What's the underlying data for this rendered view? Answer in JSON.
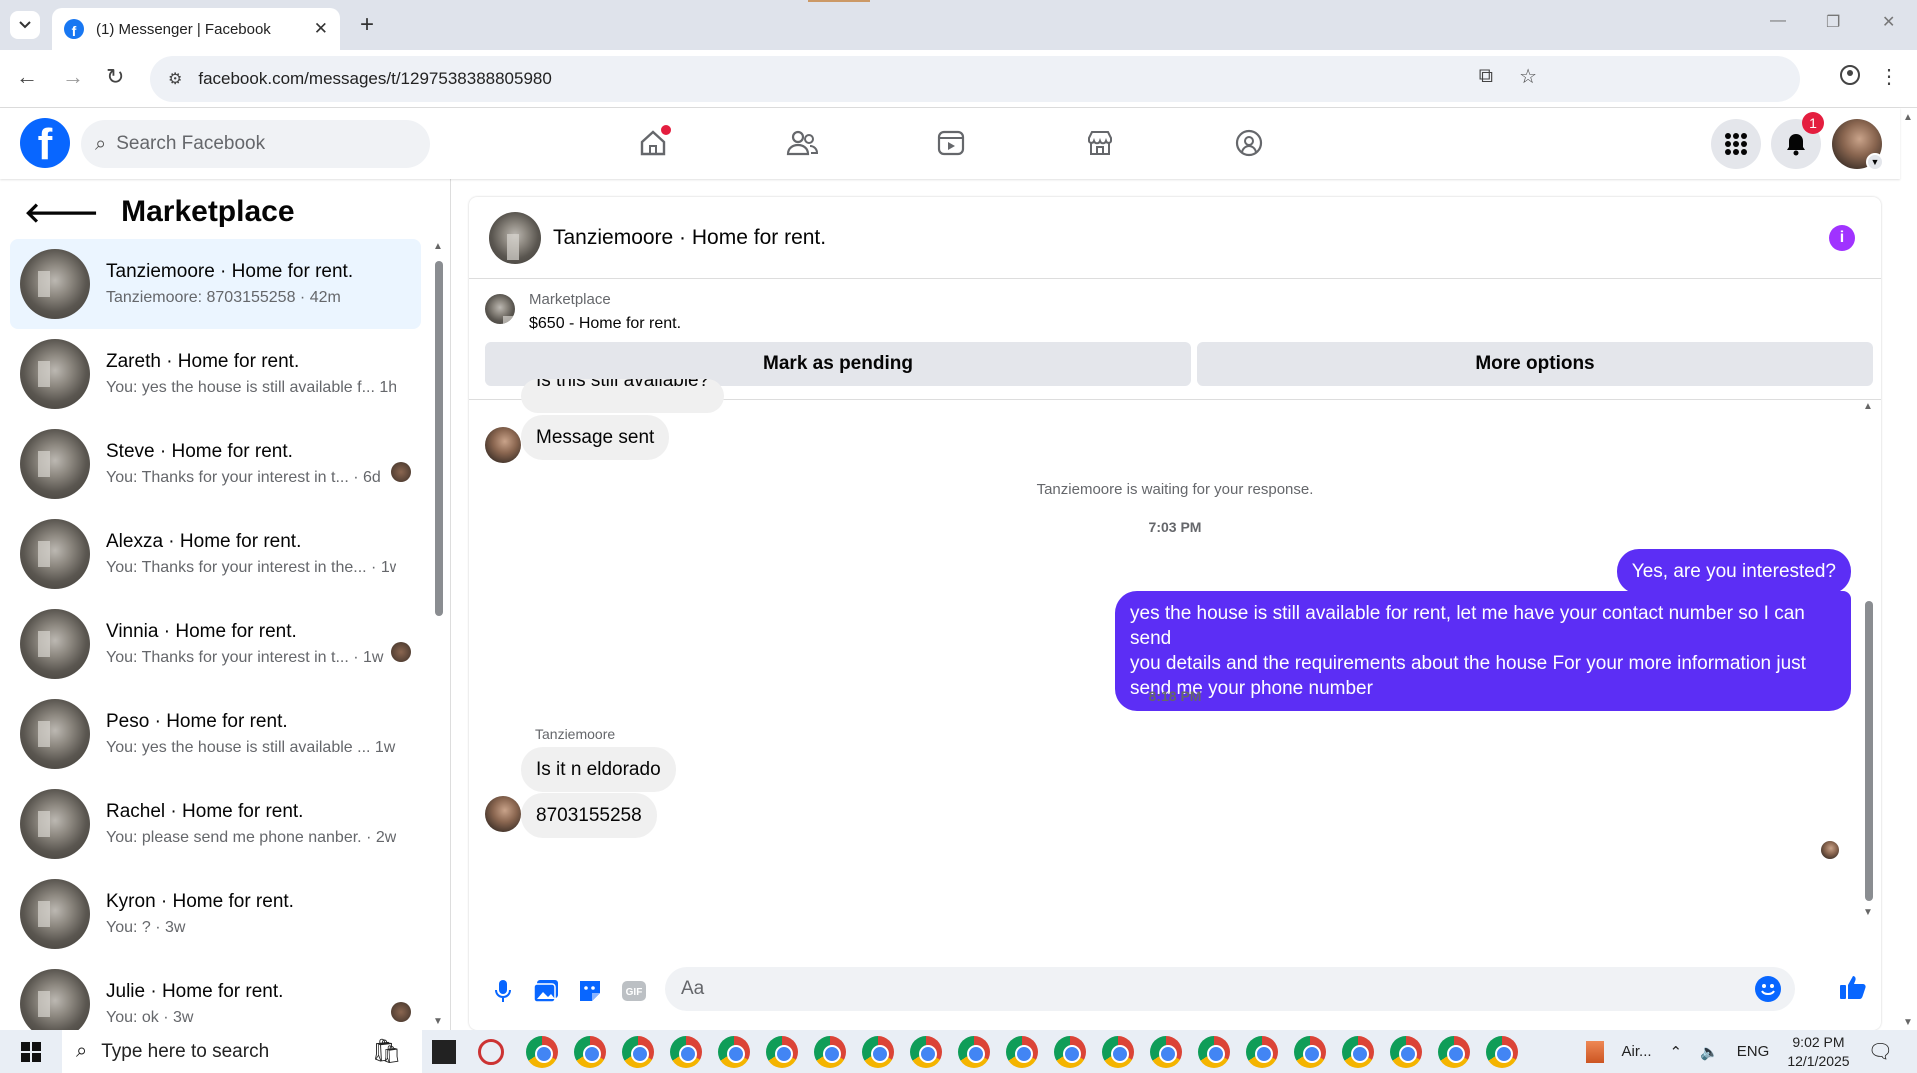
{
  "browser": {
    "tab_title": "(1) Messenger | Facebook",
    "url": "facebook.com/messages/t/1297538388805980"
  },
  "header": {
    "search_placeholder": "Search Facebook",
    "notification_count": "1"
  },
  "sidebar": {
    "title": "Marketplace",
    "conversations": [
      {
        "name": "Tanziemoore · Home for rent.",
        "preview": "Tanziemoore: 8703155258 · 42m",
        "active": true,
        "seen": false
      },
      {
        "name": "Zareth · Home for rent.",
        "preview": "You: yes the house is still available f...  1h",
        "active": false,
        "seen": false
      },
      {
        "name": "Steve · Home for rent.",
        "preview": "You: Thanks for your interest in t... · 6d",
        "active": false,
        "seen": true
      },
      {
        "name": "Alexza · Home for rent.",
        "preview": "You: Thanks for your interest in the... · 1w",
        "active": false,
        "seen": false
      },
      {
        "name": "Vinnia · Home for rent.",
        "preview": "You: Thanks for your interest in t... · 1w",
        "active": false,
        "seen": true
      },
      {
        "name": "Peso · Home for rent.",
        "preview": "You: yes the house is still available ...  1w",
        "active": false,
        "seen": false
      },
      {
        "name": "Rachel · Home for rent.",
        "preview": "You: please send me phone nanber. · 2w",
        "active": false,
        "seen": false
      },
      {
        "name": "Kyron · Home for rent.",
        "preview": "You: ? · 3w",
        "active": false,
        "seen": false
      },
      {
        "name": "Julie · Home for rent.",
        "preview": "You: ok · 3w",
        "active": false,
        "seen": true
      }
    ]
  },
  "chat": {
    "title": "Tanziemoore · Home for rent.",
    "marketplace_label": "Marketplace",
    "listing": "$650 - Home for rent.",
    "mark_pending": "Mark as pending",
    "more_options": "More options",
    "cut_off_message": "Is this still available?",
    "message_sent": "Message sent",
    "waiting_notice": "Tanziemoore is waiting for your response.",
    "time1": "7:03 PM",
    "out1": "Yes, are you interested?",
    "out2_line1": "yes the house is still available for rent, let me have your contact number so I can send",
    "out2_line2": "you details and the requirements about the house For  your  more  information  just",
    "out2_line3": "send  me   your  phone  number",
    "time2": "8:18 PM",
    "sender_label": "Tanziemoore",
    "in1": "Is it n eldorado",
    "in2": "8703155258",
    "composer_placeholder": "Aa"
  },
  "taskbar": {
    "search_placeholder": "Type here to search",
    "app_label": "Air...",
    "lang": "ENG",
    "time": "9:02 PM",
    "date": "12/1/2025"
  },
  "colors": {
    "fb_blue": "#0866ff",
    "outgoing_bubble": "#5c2ef5",
    "active_conv": "#ebf5ff"
  }
}
